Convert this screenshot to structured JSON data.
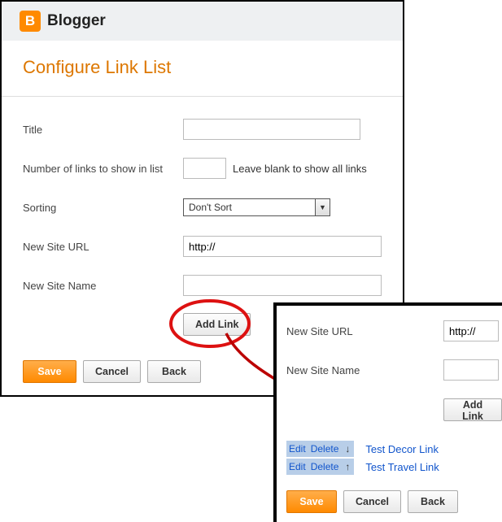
{
  "header": {
    "logo_letter": "B",
    "brand": "Blogger"
  },
  "page": {
    "title": "Configure Link List"
  },
  "form": {
    "title_label": "Title",
    "title_value": "",
    "numlinks_label": "Number of links to show in list",
    "numlinks_value": "",
    "numlinks_hint": "Leave blank to show all links",
    "sorting_label": "Sorting",
    "sorting_value": "Don't Sort",
    "url_label": "New Site URL",
    "url_value": "http://",
    "name_label": "New Site Name",
    "name_value": "",
    "addlink_label": "Add Link"
  },
  "buttons": {
    "save": "Save",
    "cancel": "Cancel",
    "back": "Back"
  },
  "popup": {
    "url_label": "New Site URL",
    "url_value": "http://",
    "name_label": "New Site Name",
    "name_value": "",
    "addlink_label": "Add Link",
    "edit_label": "Edit",
    "delete_label": "Delete",
    "down_arrow": "↓",
    "up_arrow": "↑",
    "links": [
      {
        "name": "Test Decor Link"
      },
      {
        "name": "Test Travel Link"
      }
    ],
    "save": "Save",
    "cancel": "Cancel",
    "back": "Back"
  }
}
